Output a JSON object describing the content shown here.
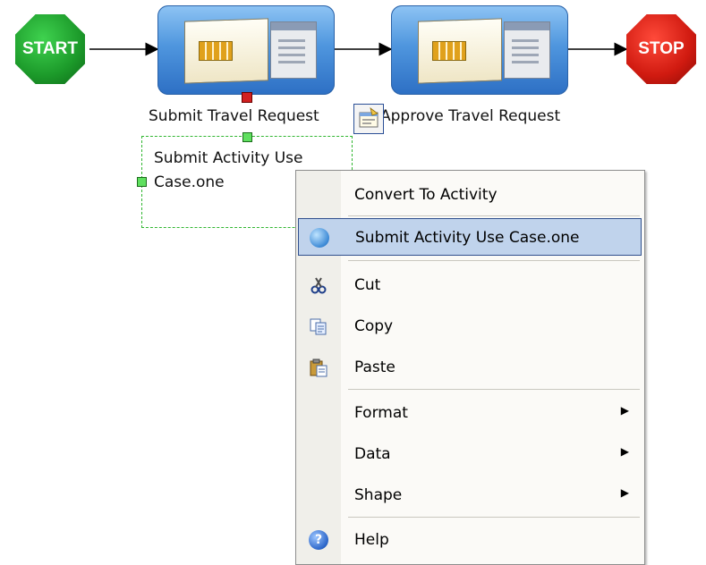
{
  "diagram": {
    "start_label": "START",
    "stop_label": "STOP",
    "activities": [
      {
        "label": "Submit Travel Request"
      },
      {
        "label": "Approve Travel Request"
      }
    ],
    "selected_shape": {
      "line1": "Submit Activity Use",
      "line2": "Case.one"
    }
  },
  "context_menu": {
    "items": [
      {
        "label": "Convert To Activity",
        "icon": "none",
        "submenu": false,
        "highlighted": false
      },
      {
        "label": "Submit Activity Use Case.one",
        "icon": "link-icon",
        "submenu": false,
        "highlighted": true
      },
      {
        "label": "Cut",
        "icon": "cut-icon",
        "submenu": false,
        "highlighted": false
      },
      {
        "label": "Copy",
        "icon": "copy-icon",
        "submenu": false,
        "highlighted": false
      },
      {
        "label": "Paste",
        "icon": "paste-icon",
        "submenu": false,
        "highlighted": false
      },
      {
        "label": "Format",
        "icon": "none",
        "submenu": true,
        "highlighted": false
      },
      {
        "label": "Data",
        "icon": "none",
        "submenu": true,
        "highlighted": false
      },
      {
        "label": "Shape",
        "icon": "none",
        "submenu": true,
        "highlighted": false
      },
      {
        "label": "Help",
        "icon": "help-icon",
        "submenu": false,
        "highlighted": false
      }
    ],
    "submenu_arrow": "▶"
  },
  "colors": {
    "start": "#1c9a2a",
    "stop": "#d01a10",
    "activity": "#4f96de",
    "highlight": "#c0d3ec",
    "selection": "#31b631"
  }
}
